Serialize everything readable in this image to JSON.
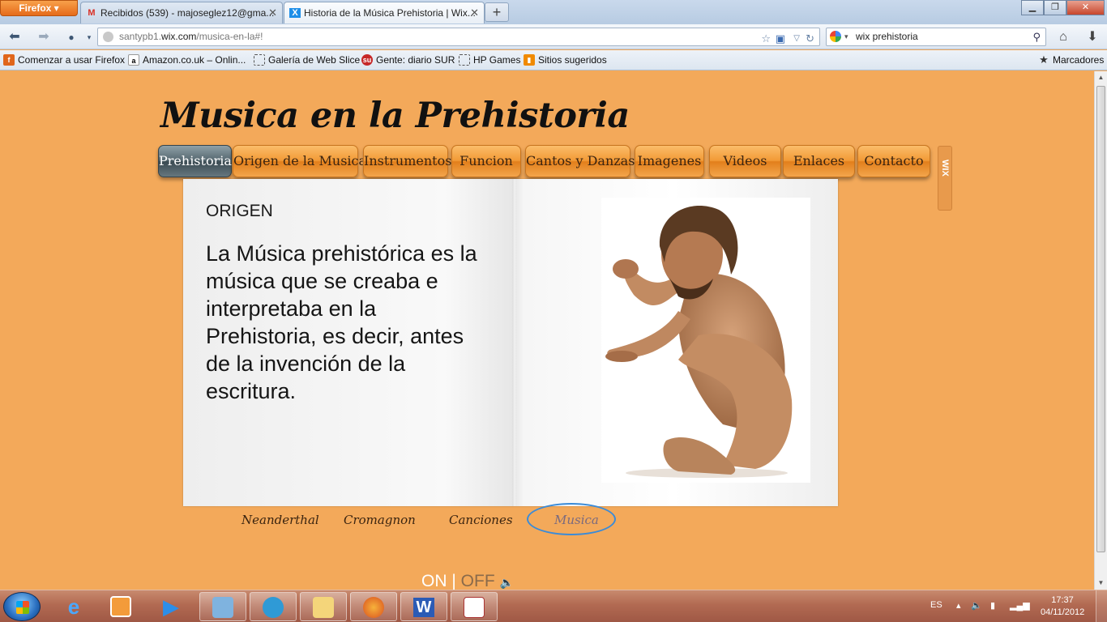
{
  "browser": {
    "menu_button": "Firefox",
    "tabs": [
      {
        "title": "Recibidos (539) - majoseglez12@gma...",
        "icon": "gmail-icon"
      },
      {
        "title": "Historia de la Música Prehistoria | Wix...",
        "icon": "wix-icon"
      }
    ],
    "url_prefix": "santypb1.",
    "url_domain": "wix.com",
    "url_path": "/musica-en-la#!",
    "search_query": "wix prehistoria",
    "bookmarks": [
      "Comenzar a usar Firefox",
      "Amazon.co.uk – Onlin...",
      "Galería de Web Slice",
      "Gente: diario SUR",
      "HP Games",
      "Sitios sugeridos"
    ],
    "bookmarks_menu": "Marcadores"
  },
  "site": {
    "title": "Musica en la Prehistoria",
    "menu": [
      "Prehistoria",
      "Origen de la Musica",
      "Instrumentos",
      "Funcion",
      "Cantos y Danzas",
      "Imagenes",
      "Videos",
      "Enlaces",
      "Contacto"
    ],
    "active_menu": "Prehistoria",
    "wix_badge": "WIX",
    "section_heading": "ORIGEN",
    "body": "La Música prehistórica es la música que se creaba e interpretaba en la Prehistoria, es decir, antes de la invención de la escritura.",
    "sub_nav": [
      "Neanderthal",
      "Cromagnon",
      "Canciones",
      "Musica"
    ],
    "active_sub_nav": "Musica",
    "audio": {
      "on": "ON",
      "separator": "|",
      "off": "OFF"
    }
  },
  "taskbar": {
    "language": "ES",
    "time": "17:37",
    "date": "04/11/2012"
  },
  "colors": {
    "page_background": "#f3a95a",
    "menu_orange": "#f29a36",
    "menu_active": "#55676f",
    "sub_nav_circle": "#3a8bd8"
  }
}
